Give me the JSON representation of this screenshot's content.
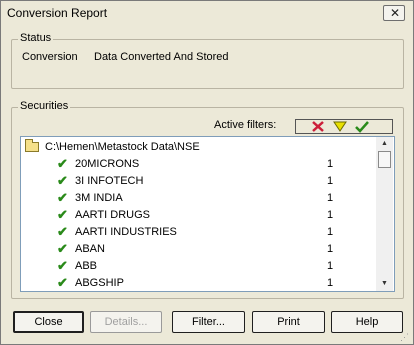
{
  "window": {
    "title": "Conversion Report",
    "close_glyph": "✕"
  },
  "status": {
    "label": "Status",
    "key": "Conversion",
    "value": "Data Converted And Stored"
  },
  "securities": {
    "label": "Securities",
    "active_filters_label": "Active filters:",
    "filter_icons": [
      "x-icon",
      "funnel-icon",
      "check-icon"
    ],
    "folder_path": "C:\\Hemen\\Metastock Data\\NSE",
    "items": [
      {
        "name": "20MICRONS",
        "count": "1"
      },
      {
        "name": "3I INFOTECH",
        "count": "1"
      },
      {
        "name": "3M INDIA",
        "count": "1"
      },
      {
        "name": "AARTI DRUGS",
        "count": "1"
      },
      {
        "name": "AARTI INDUSTRIES",
        "count": "1"
      },
      {
        "name": "ABAN",
        "count": "1"
      },
      {
        "name": "ABB",
        "count": "1"
      },
      {
        "name": "ABGSHIP",
        "count": "1"
      }
    ]
  },
  "buttons": {
    "close": "Close",
    "details": "Details...",
    "filter": "Filter...",
    "print": "Print",
    "help": "Help"
  },
  "colors": {
    "window_bg": "#ece9d8",
    "check_green": "#2a8a1a",
    "x_red": "#cc1f3a",
    "funnel_yellow": "#e8e000"
  }
}
